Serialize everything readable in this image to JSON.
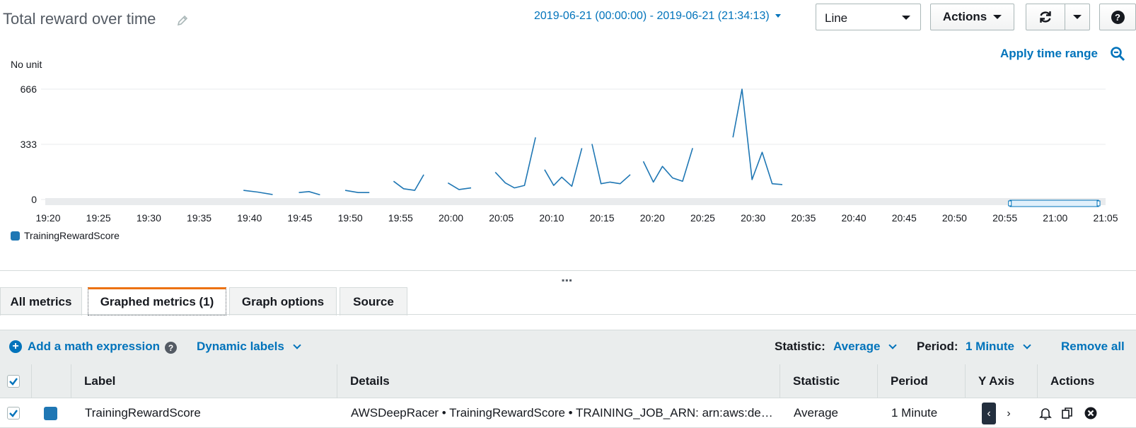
{
  "header": {
    "title": "Total reward over time",
    "date_range": "2019-06-21 (00:00:00) - 2019-06-21 (21:34:13)",
    "graph_type": "Line",
    "actions_label": "Actions",
    "help_label": "?"
  },
  "apply_time_range": "Apply time range",
  "chart_data": {
    "type": "line",
    "unit_label": "No unit",
    "y_ticks": [
      "666",
      "333",
      "0"
    ],
    "ylim": [
      0,
      666
    ],
    "x_ticks": [
      "19:20",
      "19:25",
      "19:30",
      "19:35",
      "19:40",
      "19:45",
      "19:50",
      "19:55",
      "20:00",
      "20:05",
      "20:10",
      "20:15",
      "20:20",
      "20:25",
      "20:30",
      "20:35",
      "20:40",
      "20:45",
      "20:50",
      "20:55",
      "21:00",
      "21:05"
    ],
    "x_range_minutes": [
      0,
      105
    ],
    "series": [
      {
        "name": "TrainingRewardScore",
        "color": "#1f77b4",
        "segments": [
          [
            [
              19.4,
              55
            ],
            [
              20.8,
              45
            ],
            [
              22.3,
              30
            ]
          ],
          [
            [
              24.9,
              42
            ],
            [
              25.9,
              48
            ],
            [
              27.0,
              28
            ]
          ],
          [
            [
              29.5,
              55
            ],
            [
              30.8,
              42
            ],
            [
              31.9,
              42
            ]
          ],
          [
            [
              34.3,
              110
            ],
            [
              35.3,
              65
            ],
            [
              36.4,
              55
            ],
            [
              37.3,
              150
            ]
          ],
          [
            [
              39.7,
              100
            ],
            [
              40.8,
              60
            ],
            [
              42.0,
              70
            ]
          ],
          [
            [
              44.4,
              165
            ],
            [
              45.4,
              100
            ],
            [
              46.3,
              70
            ],
            [
              47.3,
              85
            ],
            [
              48.4,
              375
            ]
          ],
          [
            [
              49.3,
              180
            ],
            [
              50.2,
              85
            ],
            [
              51.0,
              135
            ],
            [
              52.0,
              80
            ],
            [
              53.0,
              310
            ]
          ],
          [
            [
              54.0,
              335
            ],
            [
              54.9,
              95
            ],
            [
              55.8,
              105
            ],
            [
              56.8,
              95
            ],
            [
              57.8,
              150
            ]
          ],
          [
            [
              59.1,
              230
            ],
            [
              60.1,
              105
            ],
            [
              61.0,
              200
            ],
            [
              62.0,
              130
            ],
            [
              63.0,
              110
            ],
            [
              64.0,
              310
            ]
          ],
          [
            [
              68.0,
              375
            ],
            [
              68.9,
              666
            ],
            [
              69.9,
              120
            ],
            [
              70.9,
              285
            ],
            [
              71.9,
              95
            ],
            [
              72.9,
              90
            ]
          ]
        ]
      }
    ],
    "legend": [
      "TrainingRewardScore"
    ],
    "brush_range_minutes": [
      95.5,
      104.3
    ]
  },
  "tabs": [
    {
      "label": "All metrics"
    },
    {
      "label": "Graphed metrics (1)"
    },
    {
      "label": "Graph options"
    },
    {
      "label": "Source"
    }
  ],
  "toolbar": {
    "add_math": "Add a math expression",
    "dynamic_labels": "Dynamic labels",
    "statistic_label": "Statistic:",
    "statistic_value": "Average",
    "period_label": "Period:",
    "period_value": "1 Minute",
    "remove_all": "Remove all"
  },
  "table": {
    "columns": [
      "Label",
      "Details",
      "Statistic",
      "Period",
      "Y Axis",
      "Actions"
    ],
    "rows": [
      {
        "label": "TrainingRewardScore",
        "details": "AWSDeepRacer • TrainingRewardScore • TRAINING_JOB_ARN: arn:aws:de…",
        "statistic": "Average",
        "period": "1 Minute",
        "color": "#1f77b4"
      }
    ]
  }
}
